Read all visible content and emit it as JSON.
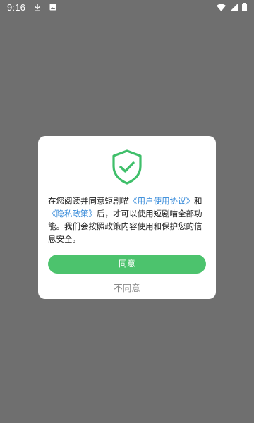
{
  "status_bar": {
    "time": "9:16",
    "left_icons": [
      "download-icon",
      "image-icon"
    ],
    "right_icons": [
      "wifi-icon",
      "signal-icon",
      "battery-icon"
    ]
  },
  "dialog": {
    "icon": "shield-check-icon",
    "accent_color": "#4cc36d",
    "link_color": "#2f86d8",
    "message": {
      "part1": "在您阅读并同意短剧喵",
      "link_terms": "《用户使用协议》",
      "part2": "和",
      "link_privacy": "《隐私政策》",
      "part3": "后，才可以使用短剧喵全部功能。我们会按照政策内容使用和保护您的信息安全。"
    },
    "agree_label": "同意",
    "disagree_label": "不同意"
  }
}
